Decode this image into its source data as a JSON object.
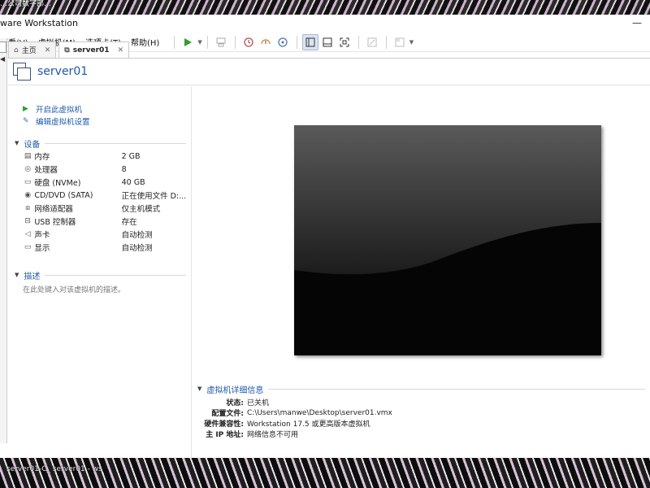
{
  "wallpaper": {
    "top_text": "…公司数字部…",
    "taskbar_text": "server01-C_ server01 - ws"
  },
  "window": {
    "title": "ware Workstation",
    "controls": "—"
  },
  "menu": {
    "items": [
      "查看(V)",
      "虚拟机(M)",
      "选项卡(T)",
      "帮助(H)"
    ]
  },
  "toolbar": {
    "icons": [
      "play-icon",
      "send-keys-icon",
      "snapshot-icon",
      "revert-snapshot-icon",
      "snapshot-manager-icon",
      "library-view-icon",
      "thumbnail-view-icon",
      "fullscreen-icon",
      "console-view-icon",
      "unity-icon"
    ]
  },
  "tabs": [
    {
      "label": "主页",
      "active": false
    },
    {
      "label": "server01",
      "active": true
    }
  ],
  "vm": {
    "name": "server01"
  },
  "actions": [
    {
      "label": "开启此虚拟机",
      "icon": "power-on-icon"
    },
    {
      "label": "编辑虚拟机设置",
      "icon": "edit-settings-icon"
    }
  ],
  "devices_section": {
    "title": "设备"
  },
  "devices": [
    {
      "icon": "memory-icon",
      "name": "内存",
      "value": "2 GB"
    },
    {
      "icon": "cpu-icon",
      "name": "处理器",
      "value": "8"
    },
    {
      "icon": "disk-icon",
      "name": "硬盘 (NVMe)",
      "value": "40 GB"
    },
    {
      "icon": "cd-icon",
      "name": "CD/DVD (SATA)",
      "value": "正在使用文件 D:..."
    },
    {
      "icon": "network-icon",
      "name": "网络适配器",
      "value": "仅主机模式"
    },
    {
      "icon": "usb-icon",
      "name": "USB 控制器",
      "value": "存在"
    },
    {
      "icon": "sound-icon",
      "name": "声卡",
      "value": "自动检测"
    },
    {
      "icon": "display-icon",
      "name": "显示",
      "value": "自动检测"
    }
  ],
  "description_section": {
    "title": "描述",
    "placeholder": "在此处键入对该虚拟机的描述。"
  },
  "details_section": {
    "title": "虚拟机详细信息"
  },
  "details": [
    {
      "key": "状态:",
      "value": "已关机"
    },
    {
      "key": "配置文件:",
      "value": "C:\\Users\\manwe\\Desktop\\server01.vmx"
    },
    {
      "key": "硬件兼容性:",
      "value": "Workstation 17.5 或更高版本虚拟机"
    },
    {
      "key": "主 IP 地址:",
      "value": "网络信息不可用"
    }
  ],
  "colors": {
    "accent": "#1c5aa6",
    "play": "#2f9e2f",
    "screen": "#050505"
  }
}
